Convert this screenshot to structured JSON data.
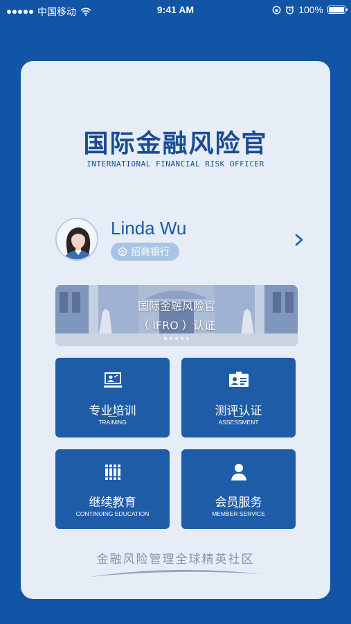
{
  "status_bar": {
    "carrier": "中国移动",
    "time": "9:41 AM",
    "battery": "100%",
    "battery_level": 1.0
  },
  "logo": {
    "title_cn": "国际金融风险官",
    "title_en": "INTERNATIONAL FINANCIAL RISK OFFICER"
  },
  "profile": {
    "name": "Linda Wu",
    "company": "招商银行"
  },
  "banner": {
    "line1": "国际金融风险官",
    "line2": "（ IFRO ）认证",
    "page_count": 5,
    "active_index": 0
  },
  "tiles": [
    {
      "label_cn": "专业培训",
      "label_en": "TRAINING",
      "icon": "presentation-icon"
    },
    {
      "label_cn": "测评认证",
      "label_en": "ASSESSMENT",
      "icon": "id-card-icon"
    },
    {
      "label_cn": "继续教育",
      "label_en": "CONTINUING EDUCATION",
      "icon": "books-icon"
    },
    {
      "label_cn": "会员服务",
      "label_en": "MEMBER SERVICE",
      "icon": "person-icon"
    }
  ],
  "slogan": "金融风险管理全球精英社区",
  "colors": {
    "background": "#1254a6",
    "card": "#e6edf6",
    "tile": "#1f5ca8",
    "accent_text": "#1a4b93",
    "badge": "#a9c4e4"
  }
}
